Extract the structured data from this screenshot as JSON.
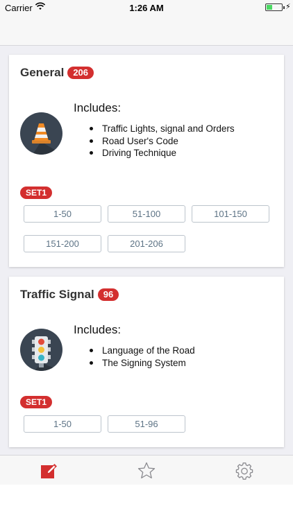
{
  "status_bar": {
    "carrier": "Carrier",
    "time": "1:26 AM",
    "battery_level": 0.35,
    "battery_color": "#4cd964"
  },
  "accent_color": "#d32f2f",
  "categories": [
    {
      "title": "General",
      "count": "206",
      "icon": "traffic-cone-icon",
      "includes_title": "Includes:",
      "includes": [
        "Traffic Lights, signal and Orders",
        "Road User's Code",
        "Driving Technique"
      ],
      "set_label": "SET1",
      "ranges": [
        "1-50",
        "51-100",
        "101-150",
        "151-200",
        "201-206"
      ]
    },
    {
      "title": "Traffic Signal",
      "count": "96",
      "icon": "traffic-light-icon",
      "includes_title": "Includes:",
      "includes": [
        "Language of the Road",
        "The Signing System"
      ],
      "set_label": "SET1",
      "ranges": [
        "1-50",
        "51-96"
      ]
    }
  ],
  "tab_bar": {
    "tabs": [
      {
        "icon": "edit-icon",
        "active": true
      },
      {
        "icon": "star-icon",
        "active": false
      },
      {
        "icon": "gear-icon",
        "active": false
      }
    ]
  }
}
